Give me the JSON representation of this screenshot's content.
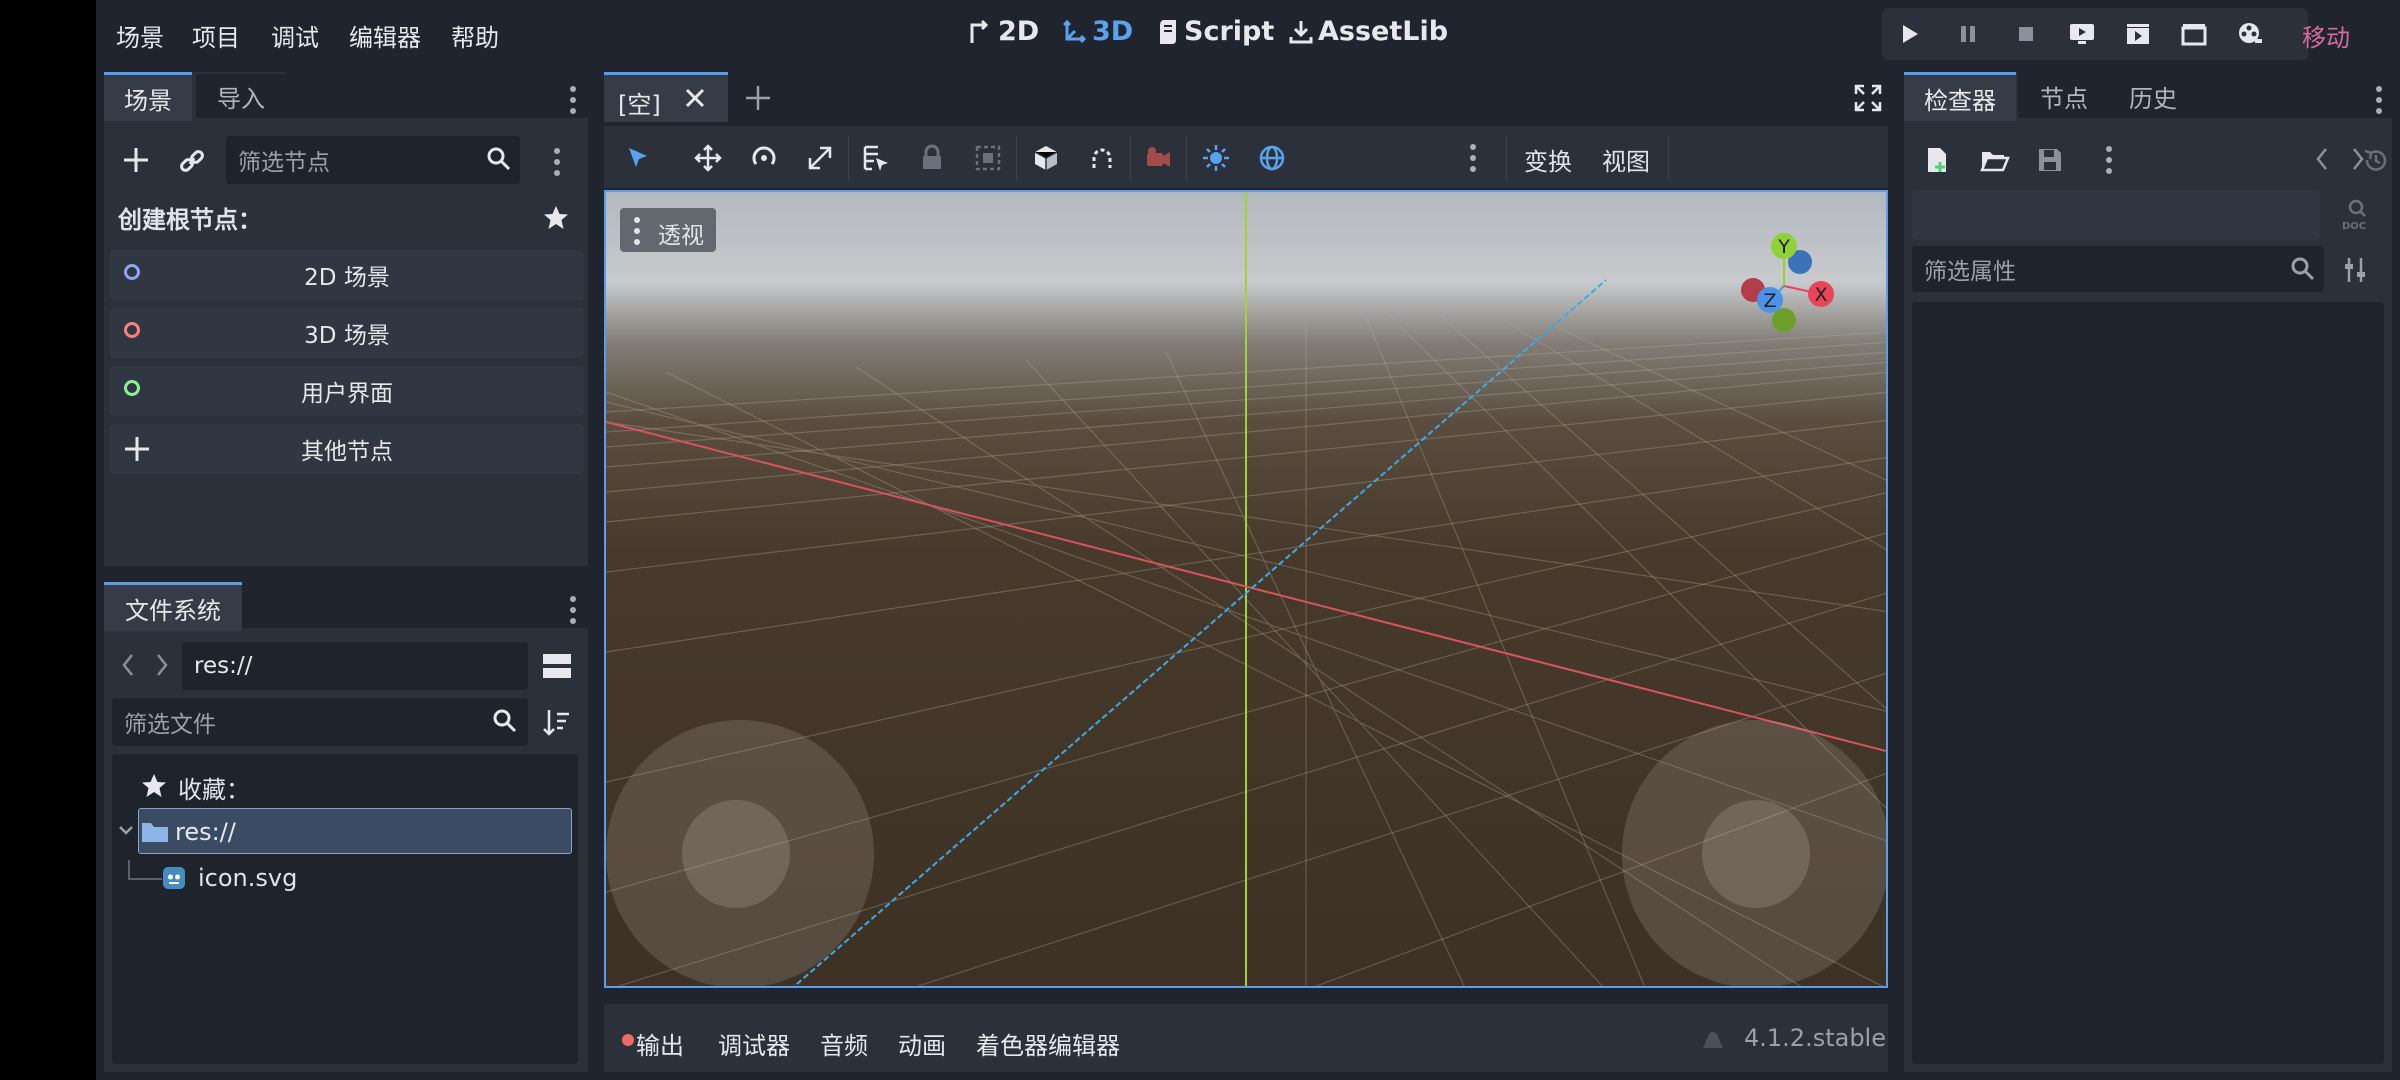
{
  "menu": {
    "items": [
      "场景",
      "项目",
      "调试",
      "编辑器",
      "帮助"
    ]
  },
  "workspaces": {
    "2d": "2D",
    "3d": "3D",
    "script": "Script",
    "assetlib": "AssetLib"
  },
  "renderer": "移动",
  "scene_dock": {
    "tabs": [
      "场景",
      "导入"
    ],
    "filter_placeholder": "筛选节点",
    "create_root_label": "创建根节点：",
    "root_options": [
      "2D 场景",
      "3D 场景",
      "用户界面",
      "其他节点"
    ]
  },
  "filesystem_dock": {
    "tab": "文件系统",
    "path": "res://",
    "filter_placeholder": "筛选文件",
    "favorites_label": "收藏：",
    "tree": {
      "root": "res://",
      "file": "icon.svg"
    }
  },
  "viewport": {
    "scene_tab": "[空]",
    "toolbar_menus": {
      "transform": "变换",
      "view": "视图"
    },
    "view_mode": "透视",
    "gizmo_axes": {
      "x": "X",
      "y": "Y",
      "z": "Z"
    }
  },
  "bottom_panel": {
    "tabs": [
      "输出",
      "调试器",
      "音频",
      "动画",
      "着色器编辑器"
    ],
    "version": "4.1.2.stable"
  },
  "inspector": {
    "tabs": [
      "检查器",
      "节点",
      "历史"
    ],
    "filter_placeholder": "筛选属性"
  },
  "colors": {
    "accent": "#5b9ee8",
    "x_axis": "#e8455a",
    "y_axis": "#8ed13b",
    "z_axis": "#4c93e8",
    "renderer_mobile": "#d66b9f",
    "output_dot": "#ee6b6b"
  }
}
